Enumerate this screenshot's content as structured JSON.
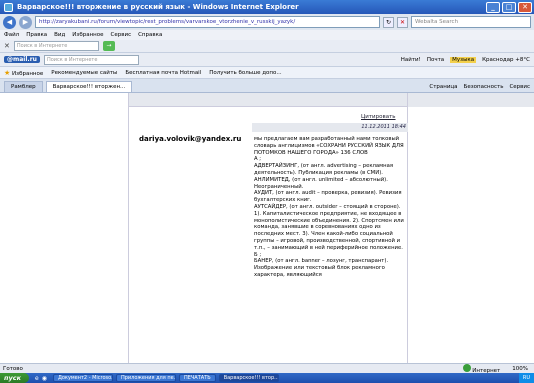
{
  "window": {
    "title": "Варварское!!! вторжение в русский язык - Windows Internet Explorer",
    "minimize": "_",
    "maximize": "□",
    "close": "✕"
  },
  "address": {
    "back": "◀",
    "forward": "▶",
    "url": "http://zaryakubani.ru/forum/viewtopic/rest_problems/varvarskoe_vtorzhenie_v_russkij_yazyk/",
    "refresh": "↻",
    "stop": "✕",
    "search_placeholder": "Webalta Search"
  },
  "menu": [
    "Файл",
    "Правка",
    "Вид",
    "Избранное",
    "Сервис",
    "Справка"
  ],
  "toolbar1": {
    "close": "✕",
    "search_placeholder": "Поиск в Интернете",
    "go": "→"
  },
  "toolbar2": {
    "logo": "@mail.ru",
    "search_placeholder": "Поиск в Интернете",
    "items": [
      "Найти!",
      "Почта",
      "Музыка",
      "Краснодар +8°C"
    ]
  },
  "favorites": {
    "label": "Избранное",
    "items": [
      "Рекомендуемые сайты",
      "Бесплатная почта Hotmail",
      "Получить больше допо..."
    ]
  },
  "tabs": [
    {
      "label": "Рамблер"
    },
    {
      "label": "Варварское!!! вторжен..."
    }
  ],
  "tab_commands": [
    "Страница",
    "Безопасность",
    "Сервис"
  ],
  "post": {
    "quote_link": "Цитировать",
    "date": "11.12.2011 18:44",
    "author": "dariya.volovik@yandex.ru",
    "body": [
      "мы предлагаем вам разработанный нами толковый словарь англицизмов «СОХРАНИ РУССКИЙ ЯЗЫК ДЛЯ ПОТОМКОВ НАШЕГО ГОРОДА» 136 СЛОВ",
      "А ;",
      "АДВЕРТАЙЗИНГ, (от англ. advertising – рекламная деятельность). Публикация рекламы (в СМИ).",
      "АНЛИМИТЕД, (от англ. unlimited – абсолютный). Неограниченный.",
      "АУДИТ, (от англ. audit – проверка, ревизия). Ревизия бухгалтерских книг.",
      "АУТСАЙДЕР, (от англ. outsider – стоящий в стороне). 1). Капиталистическое предприятие, не входящее в монополистические объединения. 2). Спортсмен или команда, занявшие в соревнованиях одно из последних мест. 3). Член какой-либо социальной группы – игровой, производственной, спортивной и т.п., – занимающий в ней периферийное положение.",
      "Б ;",
      "БАНЕР, (от англ. banner – лозунг, транспарант). Изображение или текстовый блок рекламного характера, являющийся"
    ]
  },
  "status": {
    "left": "Готово",
    "zone": "Интернет",
    "zoom": "100%"
  },
  "taskbar": {
    "start": "пуск",
    "tasks": [
      {
        "label": "Документ2 - Microso..."
      },
      {
        "label": "Приложения для пе..."
      },
      {
        "label": "ПЕЧАТАТЬ"
      },
      {
        "label": "Варварское!!! втор..."
      }
    ],
    "lang": "RU"
  }
}
